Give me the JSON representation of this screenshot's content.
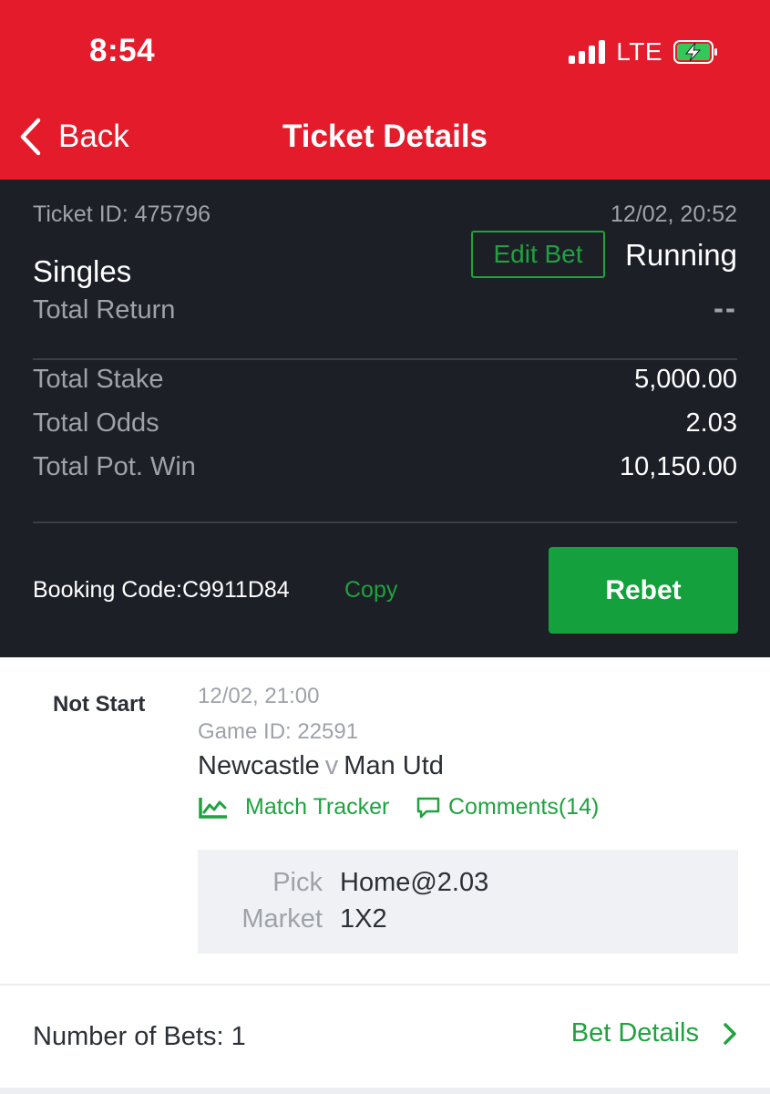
{
  "status_bar": {
    "time": "8:54",
    "network": "LTE"
  },
  "nav": {
    "back_label": "Back",
    "title": "Ticket Details"
  },
  "ticket": {
    "id_text": "Ticket ID: 475796",
    "datetime": "12/02, 20:52",
    "edit_label": "Edit Bet",
    "status": "Running",
    "bet_type": "Singles",
    "return_label": "Total Return",
    "return_value": "--",
    "rows": [
      {
        "label": "Total Stake",
        "value": "5,000.00"
      },
      {
        "label": "Total Odds",
        "value": "2.03"
      },
      {
        "label": "Total Pot. Win",
        "value": "10,150.00"
      }
    ],
    "booking_code_text": "Booking Code:C9911D84",
    "copy_label": "Copy",
    "rebet_label": "Rebet"
  },
  "selection": {
    "status": "Not Start",
    "time": "12/02, 21:00",
    "game_id_text": "Game ID: 22591",
    "home": "Newcastle",
    "vs": "v",
    "away": "Man Utd",
    "tracker_label": "Match Tracker",
    "comments_label": "Comments(14)",
    "pick_label": "Pick",
    "pick_value": "Home@2.03",
    "market_label": "Market",
    "market_value": "1X2"
  },
  "footer": {
    "num_bets_text": "Number of Bets: 1",
    "bet_details_label": "Bet Details"
  },
  "colors": {
    "header_red": "#e41b2a",
    "dark_bg": "#1c1f26",
    "accent_green": "#1fa23f",
    "button_green": "#13a03d",
    "battery_green": "#35c759"
  },
  "icons": [
    "back-chevron-icon",
    "signal-icon",
    "battery-icon",
    "tracker-icon",
    "comment-icon",
    "chevron-right-icon"
  ]
}
